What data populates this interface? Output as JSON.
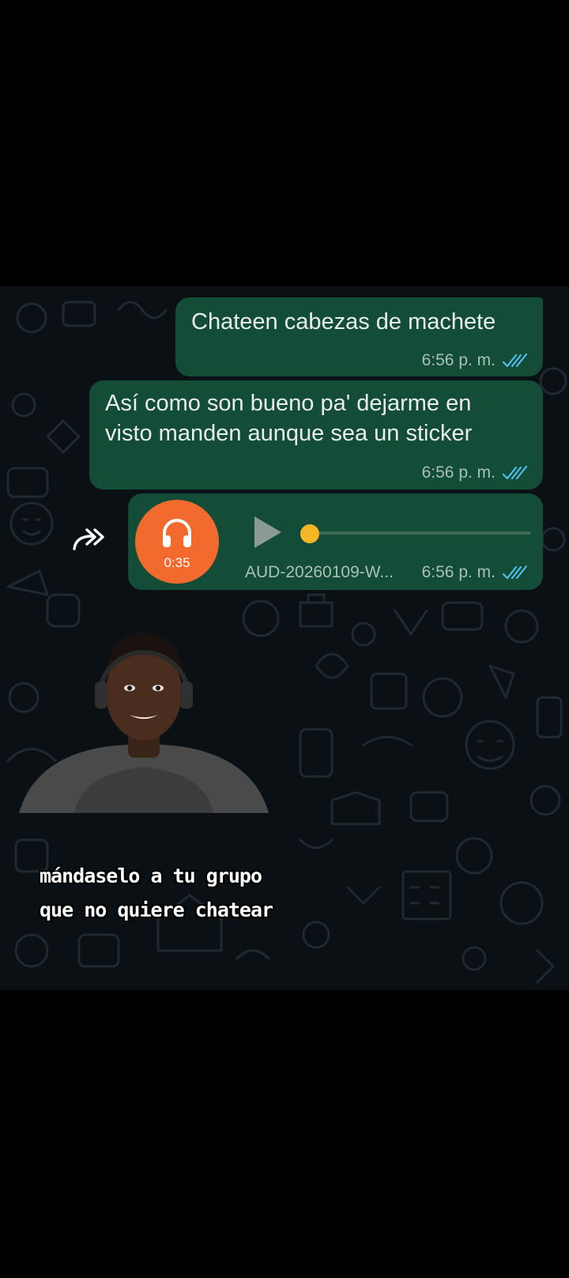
{
  "messages": [
    {
      "text": "Chateen cabezas de machete",
      "time": "6:56 p. m.",
      "status": "read"
    },
    {
      "text": "Así como son bueno pa' dejarme en\nvisto manden aunque sea un sticker",
      "time": "6:56 p. m.",
      "status": "read"
    }
  ],
  "audio_message": {
    "duration": "0:35",
    "filename": "AUD-20260109-W...",
    "time": "6:56 p. m.",
    "status": "read",
    "progress": 0.0,
    "avatar_icon": "headphones-icon",
    "avatar_color": "#f26a2d",
    "thumb_color": "#f6b628"
  },
  "forward_icon": "forward-icon",
  "caption": {
    "line1": "mándaselo a tu grupo",
    "line2": "que no quiere chatear"
  },
  "colors": {
    "bubble": "#134d37",
    "chat_background": "#0b1014",
    "ticks": "#53bdeb"
  }
}
